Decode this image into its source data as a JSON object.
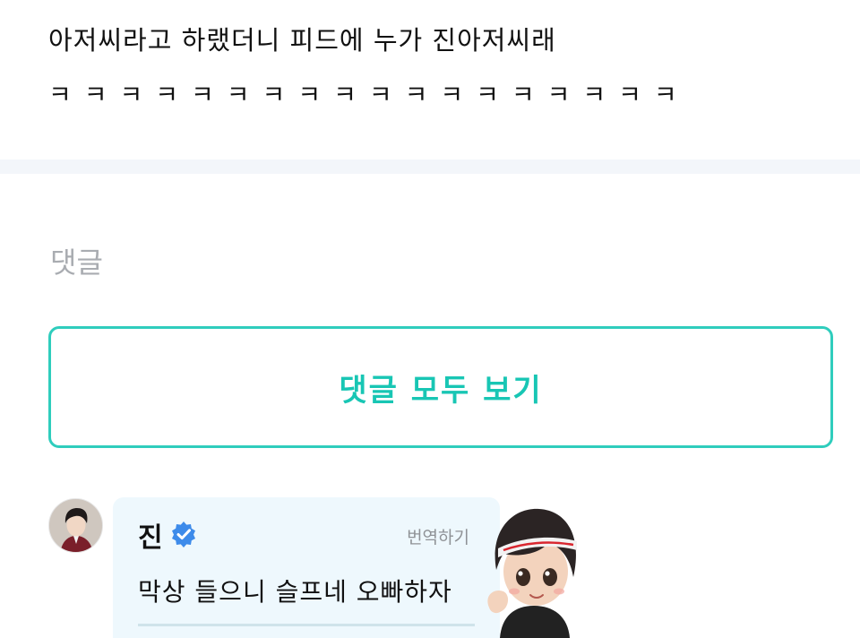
{
  "post": {
    "line1": "아저씨라고 하랬더니 피드에 누가 진아저씨래",
    "line2": "ㅋㅋㅋㅋㅋㅋㅋㅋㅋㅋㅋㅋㅋㅋㅋㅋㅋㅋ"
  },
  "comments": {
    "section_title": "댓글",
    "view_all_label": "댓글 모두 보기"
  },
  "comment": {
    "author": "진",
    "translate_label": "번역하기",
    "text": "막상 들으니 슬프네 오빠하자"
  },
  "colors": {
    "accent": "#2fcdbd",
    "verified": "#3d8bea",
    "bubble_bg": "#eef8fd",
    "section_title": "#a9acb1"
  },
  "icons": {
    "verified": "verified-badge-icon",
    "avatar": "user-avatar",
    "sticker": "character-sticker"
  }
}
